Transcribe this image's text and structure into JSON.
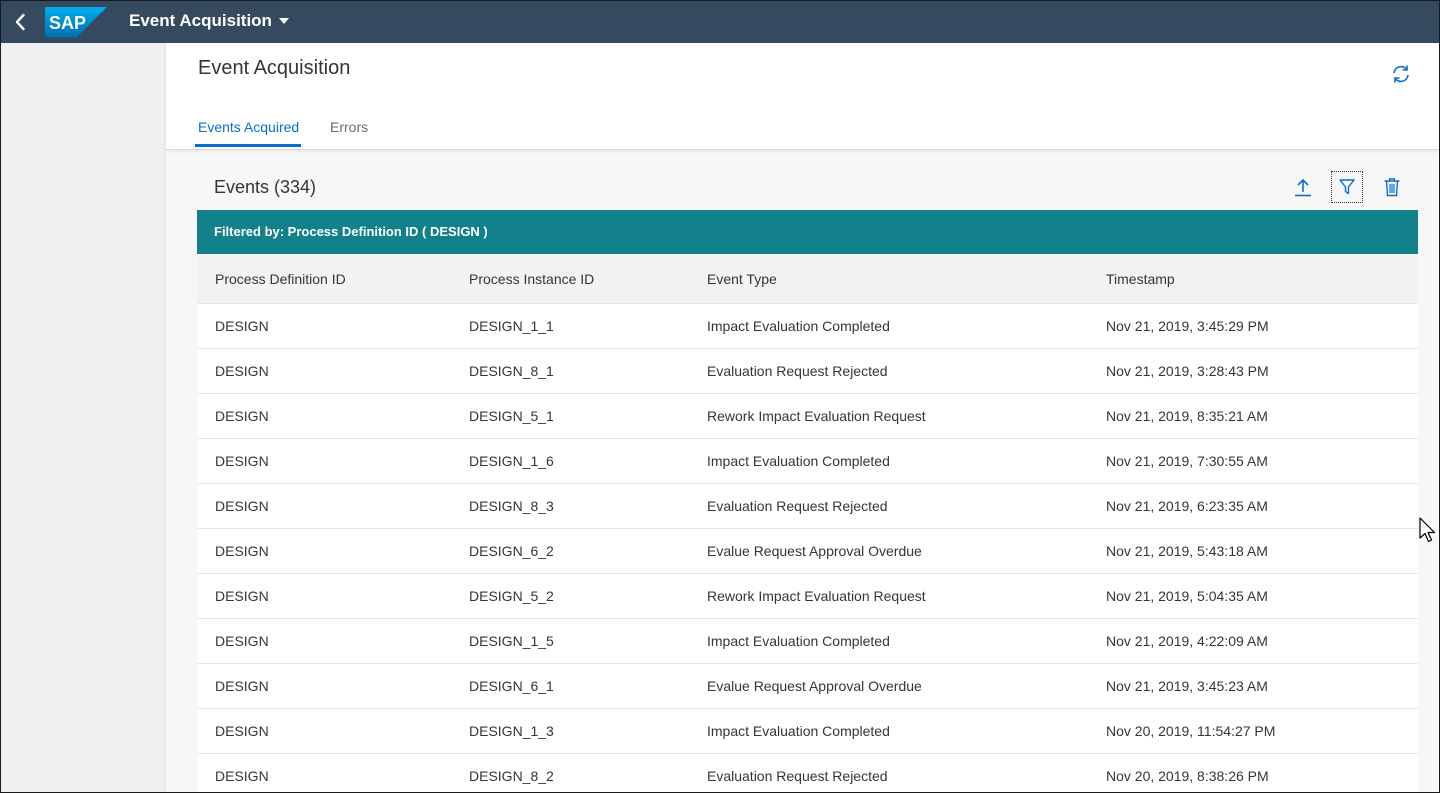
{
  "shell": {
    "logo_text": "SAP",
    "app_title": "Event Acquisition",
    "brand_color": "#0a6ed1",
    "bar_color": "#354a5f"
  },
  "header": {
    "page_title": "Event Acquisition",
    "tabs": [
      {
        "label": "Events Acquired",
        "selected": true
      },
      {
        "label": "Errors",
        "selected": false
      }
    ]
  },
  "events": {
    "title": "Events (334)",
    "filter_text": "Filtered by: Process Definition ID ( DESIGN )",
    "filter_bar_color": "#12818c",
    "toolbar_icons": [
      "upload-icon",
      "filter-icon",
      "delete-icon"
    ],
    "columns": [
      "Process Definition ID",
      "Process Instance ID",
      "Event Type",
      "Timestamp"
    ],
    "rows": [
      [
        "DESIGN",
        "DESIGN_1_1",
        "Impact Evaluation Completed",
        "Nov 21, 2019, 3:45:29 PM"
      ],
      [
        "DESIGN",
        "DESIGN_8_1",
        "Evaluation Request Rejected",
        "Nov 21, 2019, 3:28:43 PM"
      ],
      [
        "DESIGN",
        "DESIGN_5_1",
        "Rework Impact Evaluation Request",
        "Nov 21, 2019, 8:35:21 AM"
      ],
      [
        "DESIGN",
        "DESIGN_1_6",
        "Impact Evaluation Completed",
        "Nov 21, 2019, 7:30:55 AM"
      ],
      [
        "DESIGN",
        "DESIGN_8_3",
        "Evaluation Request Rejected",
        "Nov 21, 2019, 6:23:35 AM"
      ],
      [
        "DESIGN",
        "DESIGN_6_2",
        "Evalue Request Approval Overdue",
        "Nov 21, 2019, 5:43:18 AM"
      ],
      [
        "DESIGN",
        "DESIGN_5_2",
        "Rework Impact Evaluation Request",
        "Nov 21, 2019, 5:04:35 AM"
      ],
      [
        "DESIGN",
        "DESIGN_1_5",
        "Impact Evaluation Completed",
        "Nov 21, 2019, 4:22:09 AM"
      ],
      [
        "DESIGN",
        "DESIGN_6_1",
        "Evalue Request Approval Overdue",
        "Nov 21, 2019, 3:45:23 AM"
      ],
      [
        "DESIGN",
        "DESIGN_1_3",
        "Impact Evaluation Completed",
        "Nov 20, 2019, 11:54:27 PM"
      ],
      [
        "DESIGN",
        "DESIGN_8_2",
        "Evaluation Request Rejected",
        "Nov 20, 2019, 8:38:26 PM"
      ]
    ]
  }
}
